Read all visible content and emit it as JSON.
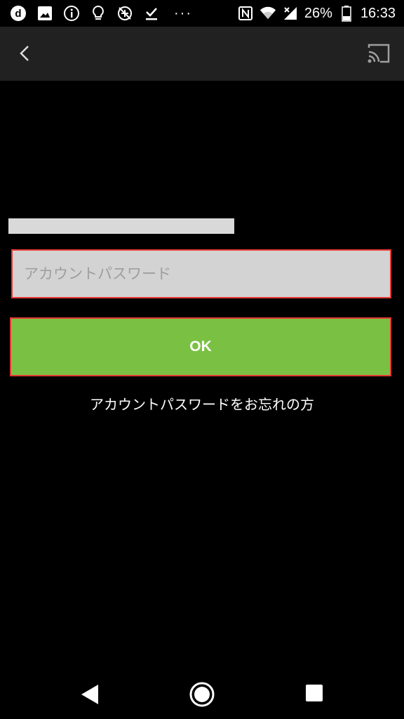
{
  "status_bar": {
    "battery_percent": "26%",
    "time": "16:33",
    "more_indicator": "···",
    "icons": [
      "docomo-d-icon",
      "image-icon",
      "info-icon",
      "bulb-icon",
      "location-crossed-icon",
      "download-done-icon",
      "nfc-icon",
      "wifi-icon",
      "signal-icon",
      "battery-icon"
    ]
  },
  "app_bar": {
    "back_icon": "chevron-left-icon",
    "cast_icon": "cast-icon"
  },
  "form": {
    "password_placeholder": "アカウントパスワード",
    "password_value": "",
    "ok_label": "OK",
    "forgot_link": "アカウントパスワードをお忘れの方"
  },
  "colors": {
    "accent_green": "#7ac143",
    "highlight_red": "#e53935",
    "field_bg": "#d3d3d3",
    "app_bar_bg": "#212121"
  },
  "nav_bar": {
    "back": "nav-back-icon",
    "home": "nav-home-icon",
    "recent": "nav-recent-icon"
  }
}
